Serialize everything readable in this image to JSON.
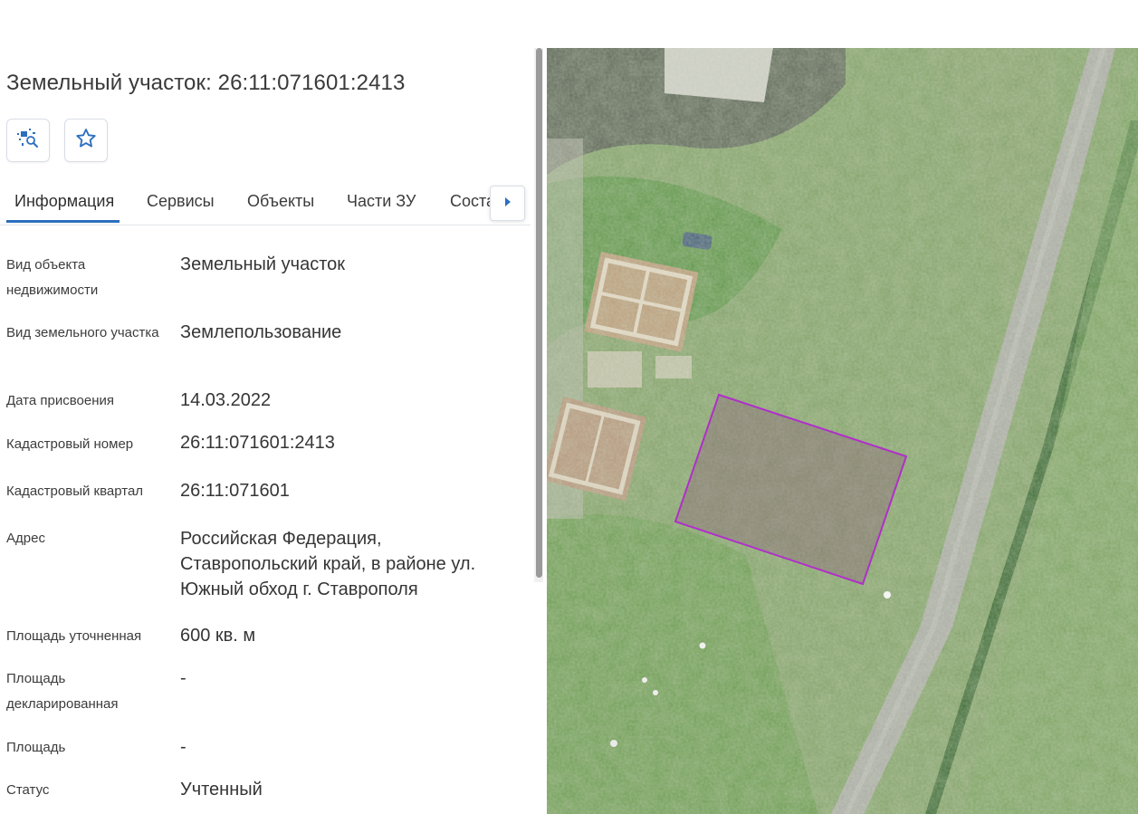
{
  "header": {
    "title": "Земельный участок: 26:11:071601:2413"
  },
  "actions": {
    "locate_icon": "map-search-icon",
    "favorite_icon": "star-outline-icon"
  },
  "tabs": [
    {
      "label": "Информация",
      "active": true
    },
    {
      "label": "Сервисы",
      "active": false
    },
    {
      "label": "Объекты",
      "active": false
    },
    {
      "label": "Части ЗУ",
      "active": false
    },
    {
      "label": "Состав",
      "active": false
    }
  ],
  "tab_scroll_icon": "chevron-right-icon",
  "details": [
    {
      "label": "Вид объекта недвижимости",
      "value": "Земельный участок"
    },
    {
      "label": "Вид земельного участка",
      "value": "Землепользование"
    },
    {
      "label": "Дата присвоения",
      "value": "14.03.2022"
    },
    {
      "label": "Кадастровый номер",
      "value": "26:11:071601:2413"
    },
    {
      "label": "Кадастровый квартал",
      "value": "26:11:071601"
    },
    {
      "label": "Адрес",
      "value": "Российская Федерация, Ставропольский край, в районе ул. Южный обход г. Ставрополя"
    },
    {
      "label": "Площадь уточненная",
      "value": "600 кв. м"
    },
    {
      "label": "Площадь декларированная",
      "value": "-"
    },
    {
      "label": "Площадь",
      "value": "-"
    },
    {
      "label": "Статус",
      "value": "Учтенный"
    }
  ],
  "colors": {
    "accent": "#2b6fbf",
    "parcel_outline": "#b02fc9"
  }
}
